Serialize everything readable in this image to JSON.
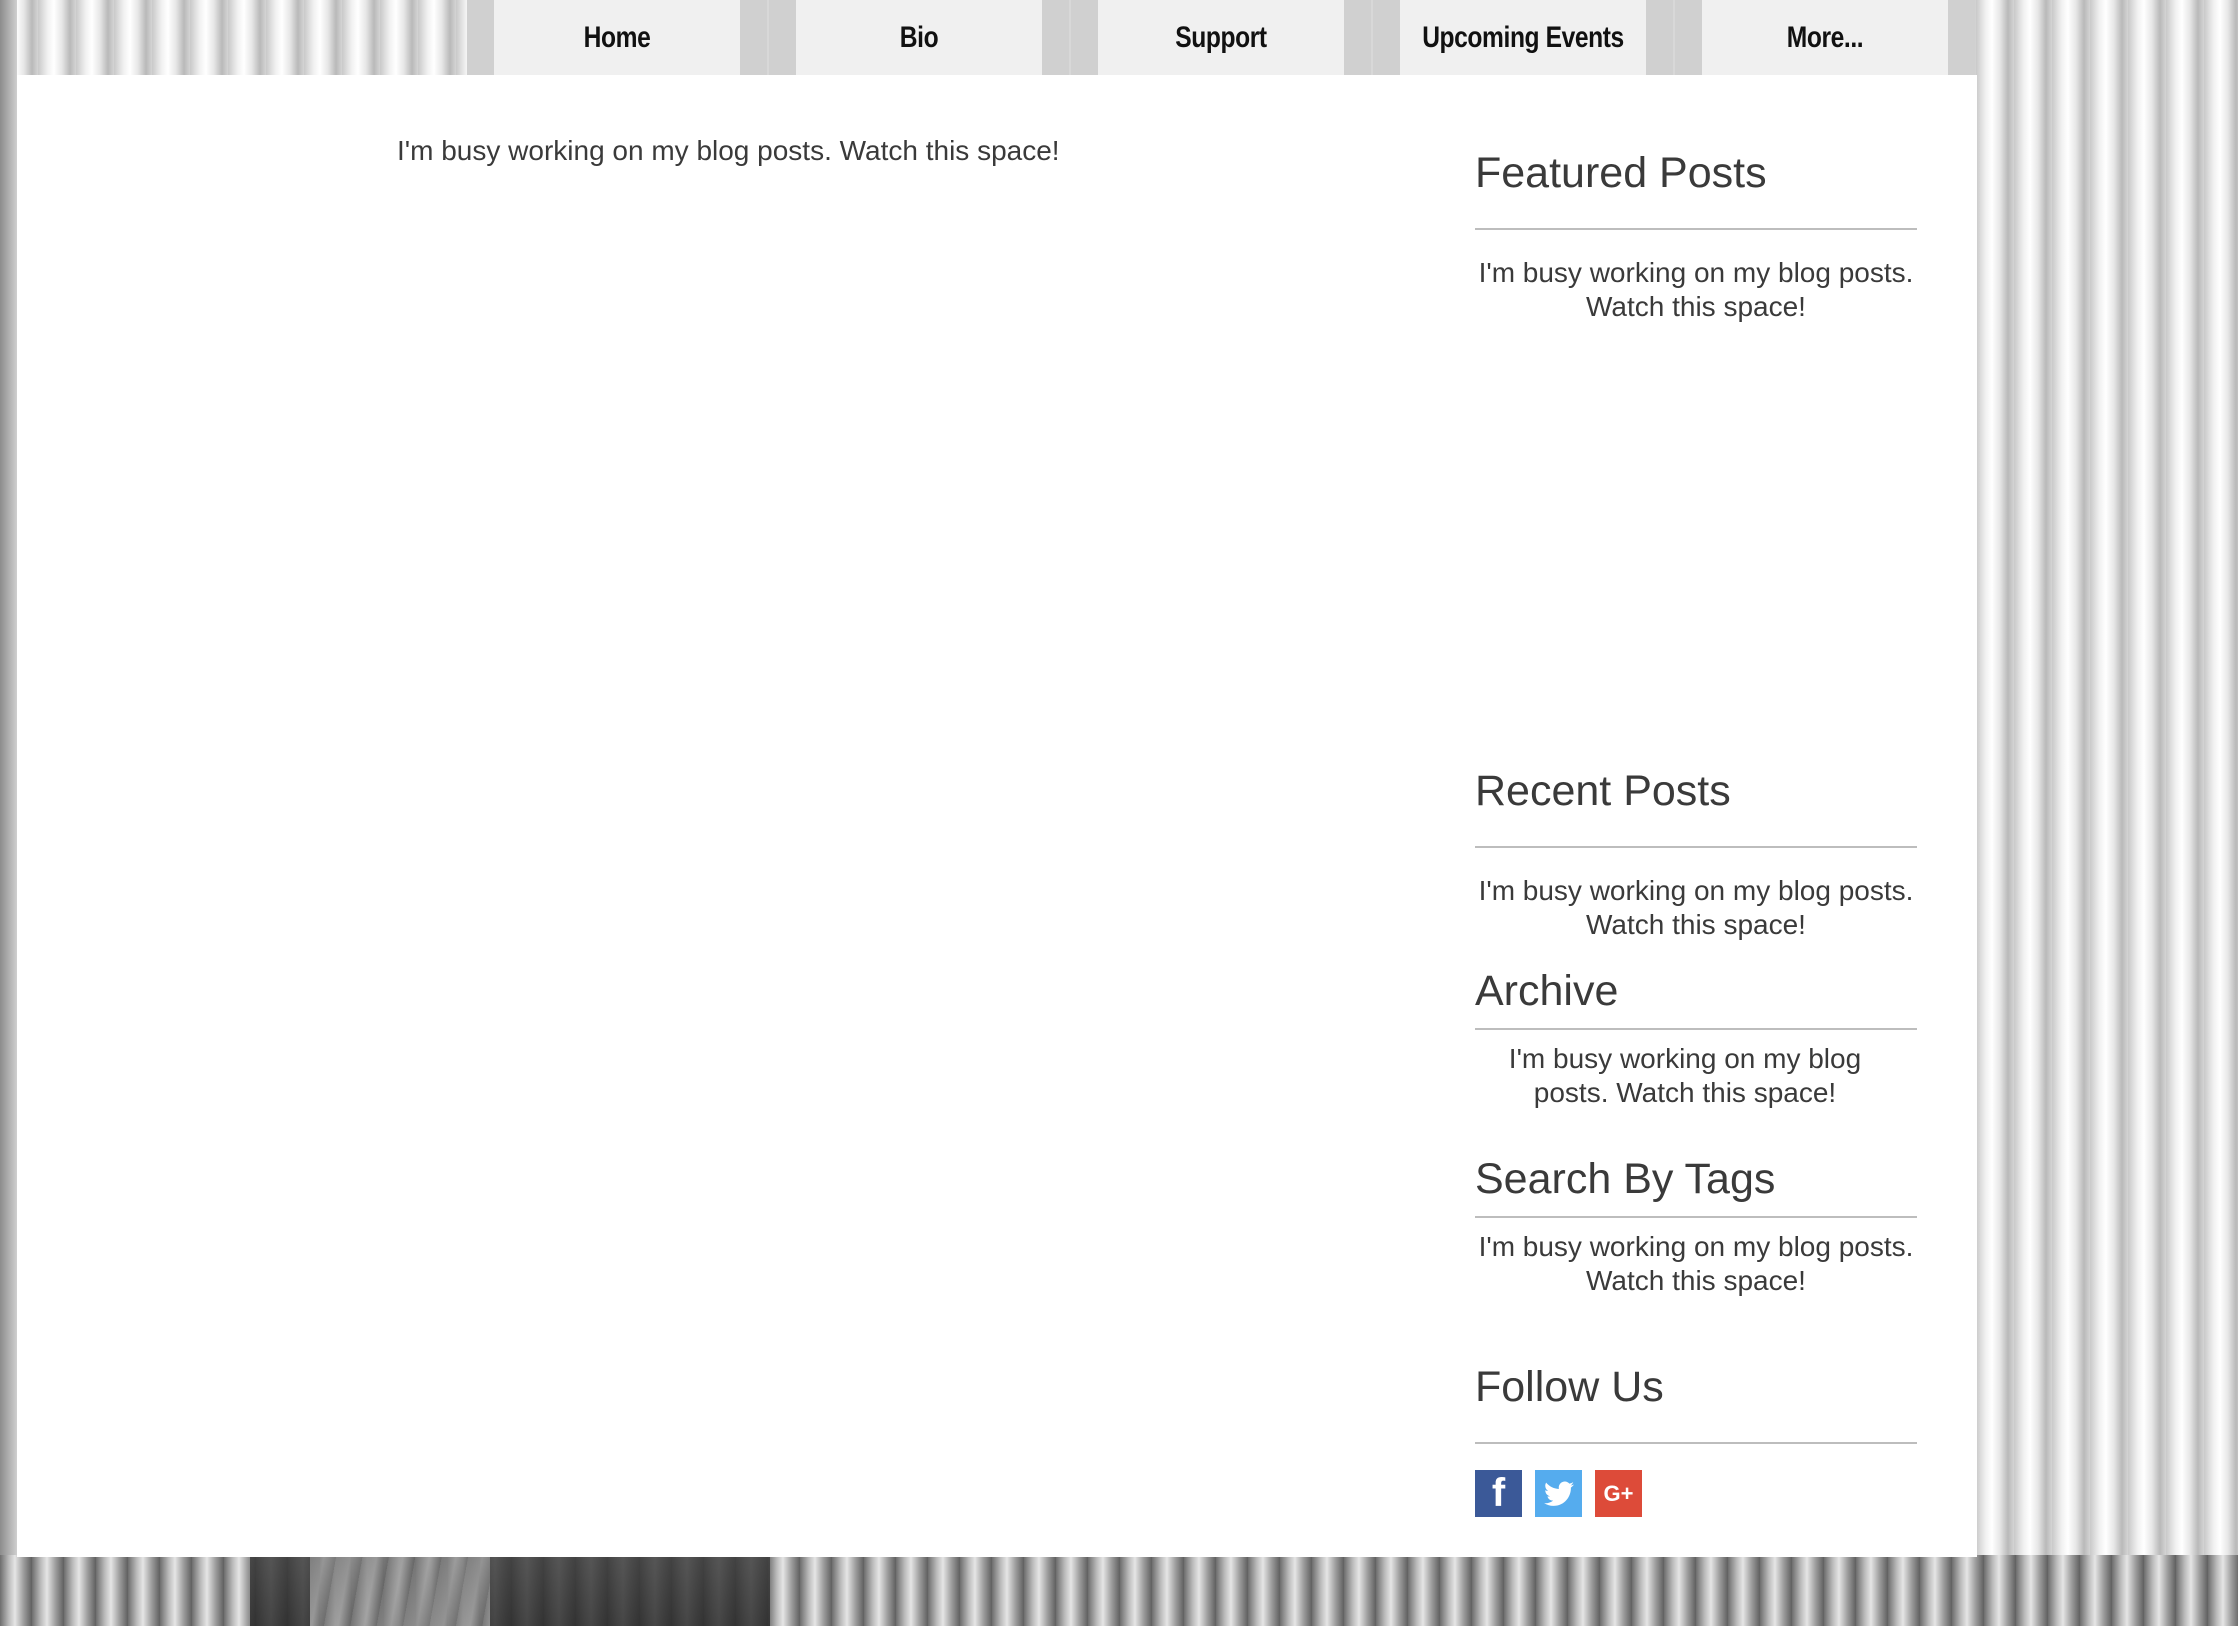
{
  "nav": {
    "items": [
      {
        "label": "Home"
      },
      {
        "label": "Bio"
      },
      {
        "label": "Support"
      },
      {
        "label": "Upcoming Events"
      },
      {
        "label": "More..."
      }
    ]
  },
  "main": {
    "blog_message": "I'm busy working on my blog posts. Watch this space!"
  },
  "sidebar": {
    "featured": {
      "title": "Featured Posts",
      "text": "I'm busy working on my blog posts. Watch this space!"
    },
    "recent": {
      "title": "Recent Posts",
      "text": "I'm busy working on my blog posts. Watch this space!"
    },
    "archive": {
      "title": "Archive",
      "text": "I'm busy working on my blog posts. Watch this space!"
    },
    "tags": {
      "title": "Search By Tags",
      "text": "I'm busy working on my blog posts. Watch this space!"
    },
    "follow": {
      "title": "Follow Us",
      "icons": [
        "facebook-icon",
        "twitter-icon",
        "google-plus-icon"
      ],
      "facebook_glyph": "f",
      "google_glyph": "G+"
    }
  },
  "colors": {
    "facebook": "#3b5998",
    "twitter": "#55acee",
    "google_plus": "#dd4b39"
  }
}
